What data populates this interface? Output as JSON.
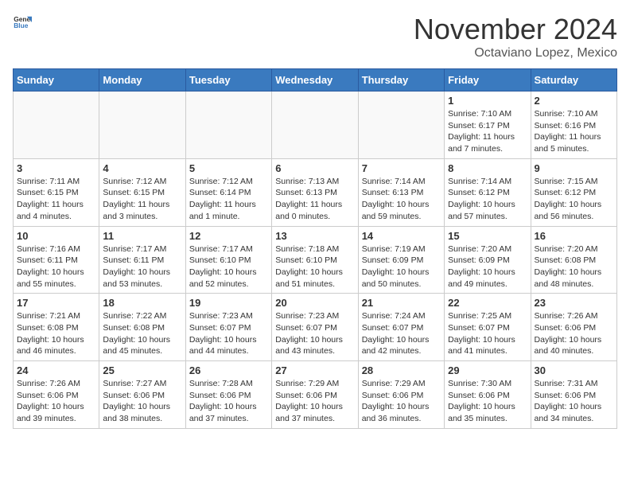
{
  "header": {
    "logo_general": "General",
    "logo_blue": "Blue",
    "month_title": "November 2024",
    "subtitle": "Octaviano Lopez, Mexico"
  },
  "calendar": {
    "days_of_week": [
      "Sunday",
      "Monday",
      "Tuesday",
      "Wednesday",
      "Thursday",
      "Friday",
      "Saturday"
    ],
    "weeks": [
      [
        {
          "day": "",
          "info": ""
        },
        {
          "day": "",
          "info": ""
        },
        {
          "day": "",
          "info": ""
        },
        {
          "day": "",
          "info": ""
        },
        {
          "day": "",
          "info": ""
        },
        {
          "day": "1",
          "info": "Sunrise: 7:10 AM\nSunset: 6:17 PM\nDaylight: 11 hours and 7 minutes."
        },
        {
          "day": "2",
          "info": "Sunrise: 7:10 AM\nSunset: 6:16 PM\nDaylight: 11 hours and 5 minutes."
        }
      ],
      [
        {
          "day": "3",
          "info": "Sunrise: 7:11 AM\nSunset: 6:15 PM\nDaylight: 11 hours and 4 minutes."
        },
        {
          "day": "4",
          "info": "Sunrise: 7:12 AM\nSunset: 6:15 PM\nDaylight: 11 hours and 3 minutes."
        },
        {
          "day": "5",
          "info": "Sunrise: 7:12 AM\nSunset: 6:14 PM\nDaylight: 11 hours and 1 minute."
        },
        {
          "day": "6",
          "info": "Sunrise: 7:13 AM\nSunset: 6:13 PM\nDaylight: 11 hours and 0 minutes."
        },
        {
          "day": "7",
          "info": "Sunrise: 7:14 AM\nSunset: 6:13 PM\nDaylight: 10 hours and 59 minutes."
        },
        {
          "day": "8",
          "info": "Sunrise: 7:14 AM\nSunset: 6:12 PM\nDaylight: 10 hours and 57 minutes."
        },
        {
          "day": "9",
          "info": "Sunrise: 7:15 AM\nSunset: 6:12 PM\nDaylight: 10 hours and 56 minutes."
        }
      ],
      [
        {
          "day": "10",
          "info": "Sunrise: 7:16 AM\nSunset: 6:11 PM\nDaylight: 10 hours and 55 minutes."
        },
        {
          "day": "11",
          "info": "Sunrise: 7:17 AM\nSunset: 6:11 PM\nDaylight: 10 hours and 53 minutes."
        },
        {
          "day": "12",
          "info": "Sunrise: 7:17 AM\nSunset: 6:10 PM\nDaylight: 10 hours and 52 minutes."
        },
        {
          "day": "13",
          "info": "Sunrise: 7:18 AM\nSunset: 6:10 PM\nDaylight: 10 hours and 51 minutes."
        },
        {
          "day": "14",
          "info": "Sunrise: 7:19 AM\nSunset: 6:09 PM\nDaylight: 10 hours and 50 minutes."
        },
        {
          "day": "15",
          "info": "Sunrise: 7:20 AM\nSunset: 6:09 PM\nDaylight: 10 hours and 49 minutes."
        },
        {
          "day": "16",
          "info": "Sunrise: 7:20 AM\nSunset: 6:08 PM\nDaylight: 10 hours and 48 minutes."
        }
      ],
      [
        {
          "day": "17",
          "info": "Sunrise: 7:21 AM\nSunset: 6:08 PM\nDaylight: 10 hours and 46 minutes."
        },
        {
          "day": "18",
          "info": "Sunrise: 7:22 AM\nSunset: 6:08 PM\nDaylight: 10 hours and 45 minutes."
        },
        {
          "day": "19",
          "info": "Sunrise: 7:23 AM\nSunset: 6:07 PM\nDaylight: 10 hours and 44 minutes."
        },
        {
          "day": "20",
          "info": "Sunrise: 7:23 AM\nSunset: 6:07 PM\nDaylight: 10 hours and 43 minutes."
        },
        {
          "day": "21",
          "info": "Sunrise: 7:24 AM\nSunset: 6:07 PM\nDaylight: 10 hours and 42 minutes."
        },
        {
          "day": "22",
          "info": "Sunrise: 7:25 AM\nSunset: 6:07 PM\nDaylight: 10 hours and 41 minutes."
        },
        {
          "day": "23",
          "info": "Sunrise: 7:26 AM\nSunset: 6:06 PM\nDaylight: 10 hours and 40 minutes."
        }
      ],
      [
        {
          "day": "24",
          "info": "Sunrise: 7:26 AM\nSunset: 6:06 PM\nDaylight: 10 hours and 39 minutes."
        },
        {
          "day": "25",
          "info": "Sunrise: 7:27 AM\nSunset: 6:06 PM\nDaylight: 10 hours and 38 minutes."
        },
        {
          "day": "26",
          "info": "Sunrise: 7:28 AM\nSunset: 6:06 PM\nDaylight: 10 hours and 37 minutes."
        },
        {
          "day": "27",
          "info": "Sunrise: 7:29 AM\nSunset: 6:06 PM\nDaylight: 10 hours and 37 minutes."
        },
        {
          "day": "28",
          "info": "Sunrise: 7:29 AM\nSunset: 6:06 PM\nDaylight: 10 hours and 36 minutes."
        },
        {
          "day": "29",
          "info": "Sunrise: 7:30 AM\nSunset: 6:06 PM\nDaylight: 10 hours and 35 minutes."
        },
        {
          "day": "30",
          "info": "Sunrise: 7:31 AM\nSunset: 6:06 PM\nDaylight: 10 hours and 34 minutes."
        }
      ]
    ]
  }
}
